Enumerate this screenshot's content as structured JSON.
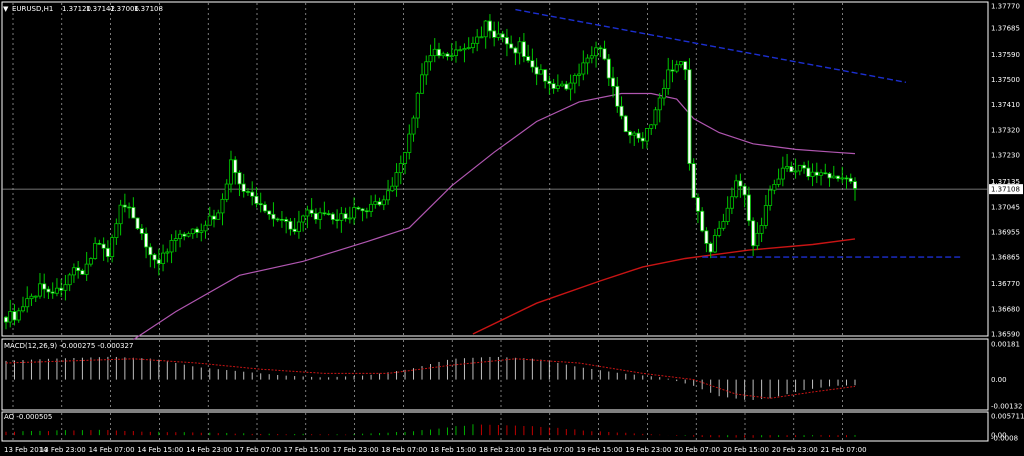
{
  "app": {
    "symbol": "EURUSD,H1",
    "quote": {
      "open": "1.37120",
      "high": "1.37142",
      "low": "1.37006",
      "close": "1.37108"
    },
    "macd_label": "MACD(12,26,9) -0.000275 -0.000327",
    "ao_label": "AO -0.000505",
    "colors": {
      "background": "#000000",
      "candle": "#00c800",
      "ma_fast": "#b056b0",
      "ma_slow": "#c81414",
      "trendline": "#1c2fd1",
      "grid": "#ffffff",
      "macd_hist": "#c0c0c0",
      "macd_signal": "#c81414",
      "ao_up": "#00b000",
      "ao_down": "#c00000"
    }
  },
  "chart_data": [
    {
      "type": "candlestick",
      "title": "EURUSD,H1",
      "ylim": [
        1.3659,
        1.3777
      ],
      "y_ticks": [
        "1.37770",
        "1.37685",
        "1.37590",
        "1.37500",
        "1.37410",
        "1.37320",
        "1.37230",
        "1.37135",
        "1.37045",
        "1.36955",
        "1.36865",
        "1.36770",
        "1.36680",
        "1.36590"
      ],
      "y_tick_values": [
        1.3777,
        1.37685,
        1.3759,
        1.375,
        1.3741,
        1.3732,
        1.3723,
        1.37135,
        1.37045,
        1.36955,
        1.36865,
        1.3677,
        1.3668,
        1.3659
      ],
      "current_price": "1.37108",
      "x_ticks": [
        "13 Feb 2014",
        "13 Feb 23:00",
        "14 Feb 07:00",
        "14 Feb 15:00",
        "14 Feb 23:00",
        "17 Feb 07:00",
        "17 Feb 15:00",
        "17 Feb 23:00",
        "18 Feb 07:00",
        "18 Feb 15:00",
        "18 Feb 23:00",
        "19 Feb 07:00",
        "19 Feb 15:00",
        "19 Feb 23:00",
        "20 Feb 07:00",
        "20 Feb 15:00",
        "20 Feb 23:00",
        "21 Feb 07:00"
      ],
      "close_path": [
        [
          0,
          1.3665
        ],
        [
          3,
          1.3666
        ],
        [
          6,
          1.3672
        ],
        [
          8,
          1.3676
        ],
        [
          12,
          1.3674
        ],
        [
          16,
          1.3681
        ],
        [
          18,
          1.3679
        ],
        [
          21,
          1.3692
        ],
        [
          24,
          1.3688
        ],
        [
          27,
          1.3704
        ],
        [
          30,
          1.3702
        ],
        [
          33,
          1.369
        ],
        [
          36,
          1.3685
        ],
        [
          40,
          1.3693
        ],
        [
          44,
          1.3695
        ],
        [
          48,
          1.37
        ],
        [
          50,
          1.3702
        ],
        [
          53,
          1.372
        ],
        [
          56,
          1.371
        ],
        [
          59,
          1.3706
        ],
        [
          62,
          1.3702
        ],
        [
          65,
          1.37
        ],
        [
          68,
          1.3697
        ],
        [
          71,
          1.3702
        ],
        [
          74,
          1.3701
        ],
        [
          77,
          1.37
        ],
        [
          80,
          1.3701
        ],
        [
          82,
          1.3703
        ],
        [
          84,
          1.3702
        ],
        [
          87,
          1.3705
        ],
        [
          89,
          1.3708
        ],
        [
          91,
          1.3712
        ],
        [
          93,
          1.372
        ],
        [
          95,
          1.373
        ],
        [
          97,
          1.3745
        ],
        [
          99,
          1.3756
        ],
        [
          101,
          1.376
        ],
        [
          103,
          1.3758
        ],
        [
          105,
          1.3759
        ],
        [
          107,
          1.376
        ],
        [
          109,
          1.3762
        ],
        [
          111,
          1.3764
        ],
        [
          113,
          1.377
        ],
        [
          115,
          1.3766
        ],
        [
          117,
          1.3764
        ],
        [
          119,
          1.376
        ],
        [
          121,
          1.3762
        ],
        [
          123,
          1.3756
        ],
        [
          126,
          1.3752
        ],
        [
          129,
          1.3748
        ],
        [
          132,
          1.3746
        ],
        [
          135,
          1.3752
        ],
        [
          138,
          1.376
        ],
        [
          140,
          1.3762
        ],
        [
          142,
          1.375
        ],
        [
          144,
          1.3742
        ],
        [
          146,
          1.373
        ],
        [
          148,
          1.3732
        ],
        [
          150,
          1.3728
        ],
        [
          152,
          1.3735
        ],
        [
          154,
          1.3745
        ],
        [
          156,
          1.3752
        ],
        [
          158,
          1.3756
        ],
        [
          160,
          1.3755
        ],
        [
          161,
          1.372
        ],
        [
          162,
          1.3708
        ],
        [
          164,
          1.3696
        ],
        [
          166,
          1.369
        ],
        [
          168,
          1.3696
        ],
        [
          170,
          1.3705
        ],
        [
          172,
          1.3714
        ],
        [
          174,
          1.3708
        ],
        [
          175,
          1.37
        ],
        [
          176,
          1.369
        ],
        [
          178,
          1.3698
        ],
        [
          180,
          1.3712
        ],
        [
          182,
          1.3716
        ],
        [
          184,
          1.3719
        ],
        [
          186,
          1.3718
        ],
        [
          188,
          1.3718
        ],
        [
          190,
          1.3716
        ],
        [
          192,
          1.3717
        ],
        [
          194,
          1.3716
        ],
        [
          196,
          1.3714
        ],
        [
          198,
          1.3715
        ],
        [
          199,
          1.3712
        ],
        [
          200,
          1.37108
        ]
      ],
      "ma_fast_path": [
        [
          30,
          1.3657
        ],
        [
          40,
          1.3667
        ],
        [
          55,
          1.368
        ],
        [
          70,
          1.3685
        ],
        [
          85,
          1.3692
        ],
        [
          95,
          1.3697
        ],
        [
          105,
          1.3712
        ],
        [
          115,
          1.3724
        ],
        [
          125,
          1.3735
        ],
        [
          135,
          1.3742
        ],
        [
          145,
          1.3745
        ],
        [
          152,
          1.3745
        ],
        [
          158,
          1.3743
        ],
        [
          162,
          1.3736
        ],
        [
          168,
          1.3731
        ],
        [
          176,
          1.3727
        ],
        [
          186,
          1.3725
        ],
        [
          195,
          1.3724
        ],
        [
          200,
          1.37235
        ]
      ],
      "ma_slow_path": [
        [
          110,
          1.3659
        ],
        [
          125,
          1.367
        ],
        [
          140,
          1.3678
        ],
        [
          150,
          1.3683
        ],
        [
          160,
          1.3686
        ],
        [
          175,
          1.3689
        ],
        [
          190,
          1.3691
        ],
        [
          200,
          1.3693
        ]
      ],
      "trendline": {
        "from": [
          120,
          1.3775
        ],
        "to": [
          212,
          1.3749
        ]
      },
      "support_line": {
        "from": [
          164,
          1.36865
        ],
        "to": [
          225,
          1.36865
        ]
      }
    },
    {
      "type": "histogram",
      "title": "MACD(12,26,9) -0.000275 -0.000327",
      "ylim": [
        -0.00132,
        0.00181
      ],
      "y_ticks": [
        "0.00181",
        "0.00",
        "-0.00132"
      ],
      "y_tick_values": [
        0.00181,
        0.0,
        -0.00132
      ],
      "hist_path": [
        [
          0,
          0.0009
        ],
        [
          10,
          0.001
        ],
        [
          25,
          0.0011
        ],
        [
          35,
          0.001
        ],
        [
          45,
          0.0006
        ],
        [
          55,
          0.0004
        ],
        [
          65,
          0.0002
        ],
        [
          75,
          0.0001
        ],
        [
          85,
          0.0002
        ],
        [
          95,
          0.0005
        ],
        [
          105,
          0.001
        ],
        [
          115,
          0.0011
        ],
        [
          125,
          0.001
        ],
        [
          135,
          0.0006
        ],
        [
          145,
          0.0003
        ],
        [
          155,
          0.0001
        ],
        [
          162,
          -0.0003
        ],
        [
          168,
          -0.0008
        ],
        [
          175,
          -0.001
        ],
        [
          180,
          -0.0009
        ],
        [
          188,
          -0.0005
        ],
        [
          195,
          -0.0003
        ],
        [
          200,
          -0.000275
        ]
      ],
      "signal_path": [
        [
          0,
          0.0008
        ],
        [
          15,
          0.0009
        ],
        [
          30,
          0.001
        ],
        [
          45,
          0.0008
        ],
        [
          60,
          0.0005
        ],
        [
          75,
          0.0003
        ],
        [
          90,
          0.0003
        ],
        [
          105,
          0.0007
        ],
        [
          120,
          0.001
        ],
        [
          135,
          0.0008
        ],
        [
          150,
          0.0003
        ],
        [
          162,
          0.0
        ],
        [
          172,
          -0.0007
        ],
        [
          180,
          -0.0009
        ],
        [
          190,
          -0.0006
        ],
        [
          200,
          -0.000327
        ]
      ]
    },
    {
      "type": "histogram",
      "title": "AO -0.000505",
      "ylim": [
        -0.0008,
        0.005711
      ],
      "y_ticks": [
        "0.005711",
        "0.00",
        "-0.0008"
      ],
      "y_tick_values": [
        0.005711,
        0.0,
        -0.0008
      ],
      "hist_path": [
        [
          0,
          0.001
        ],
        [
          20,
          0.0015
        ],
        [
          40,
          0.0008
        ],
        [
          60,
          0.0004
        ],
        [
          80,
          0.0002
        ],
        [
          95,
          0.001
        ],
        [
          110,
          0.003
        ],
        [
          125,
          0.0025
        ],
        [
          140,
          0.001
        ],
        [
          155,
          0.0
        ],
        [
          165,
          -0.0005
        ],
        [
          175,
          -0.0007
        ],
        [
          190,
          -0.0004
        ],
        [
          200,
          -0.000505
        ]
      ]
    }
  ]
}
